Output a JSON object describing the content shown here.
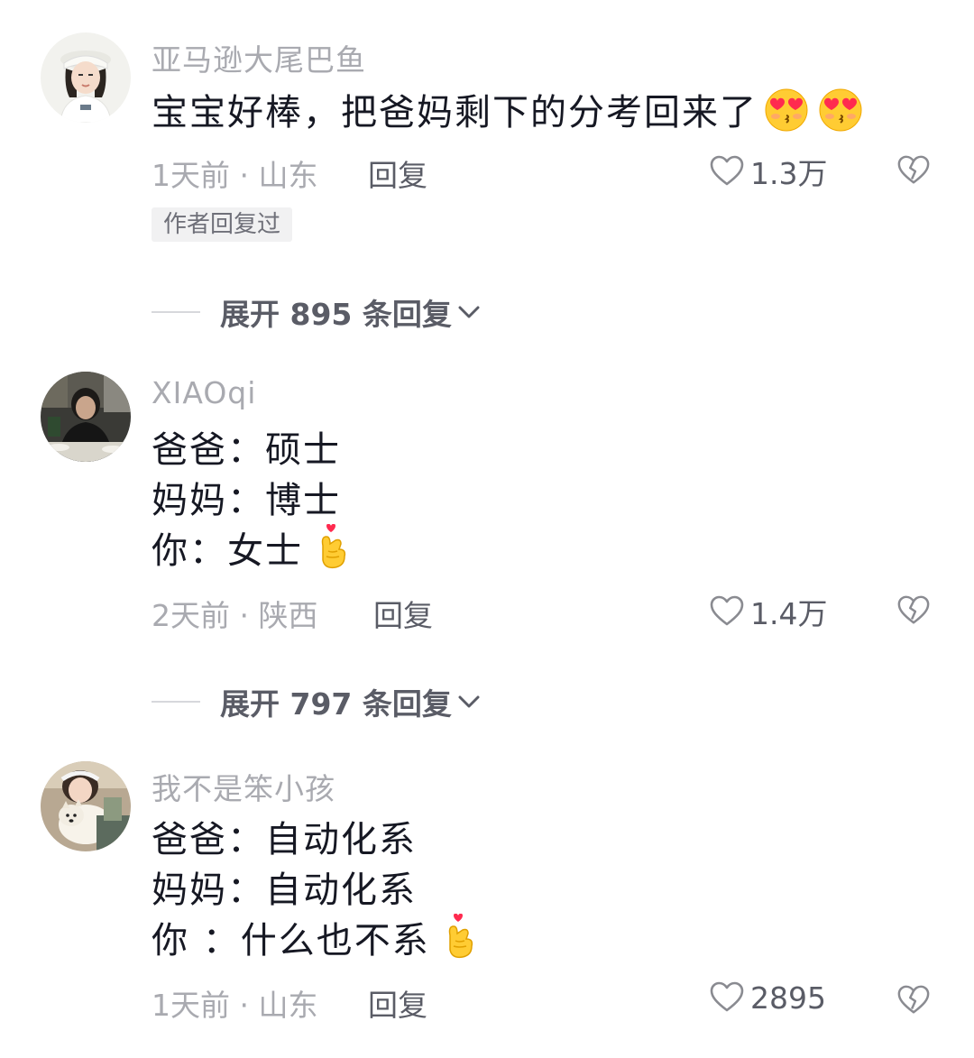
{
  "comments": [
    {
      "username": "亚马逊大尾巴鱼",
      "lines": [
        "宝宝好棒，把爸妈剩下的分考回来了"
      ],
      "emoji": "smiling-face-with-heart-eyes-kiss",
      "time_location": "1天前 · 山东",
      "reply_label": "回复",
      "like_count": "1.3万",
      "badge": "作者回复过",
      "expand_text": "展开 895 条回复"
    },
    {
      "username": "XIAOqi",
      "lines": [
        "爸爸：硕士",
        "妈妈：博士",
        "你：女士"
      ],
      "emoji": "finger-heart",
      "time_location": "2天前 · 陕西",
      "reply_label": "回复",
      "like_count": "1.4万",
      "expand_text": "展开 797 条回复"
    },
    {
      "username": "我不是笨小孩",
      "lines": [
        "爸爸：自动化系",
        "妈妈：自动化系",
        "你 ：什么也不系"
      ],
      "emoji": "finger-heart",
      "time_location": "1天前 · 山东",
      "reply_label": "回复",
      "like_count": "2895"
    }
  ],
  "colors": {
    "text_primary": "#161823",
    "text_secondary": "#a9aab0",
    "text_action": "#5a5c66",
    "badge_bg": "#f1f1f2"
  },
  "icons": [
    "heart-outline-icon",
    "broken-heart-icon",
    "chevron-down-icon"
  ]
}
